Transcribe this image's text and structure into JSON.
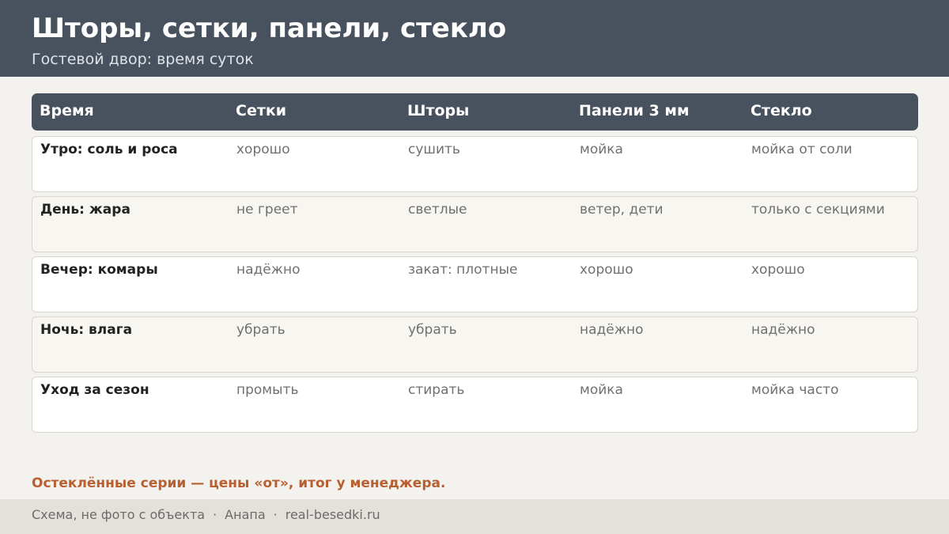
{
  "header": {
    "title": "Шторы, сетки, панели, стекло",
    "subtitle": "Гостевой двор: время суток"
  },
  "table": {
    "columns": [
      "Время",
      "Сетки",
      "Шторы",
      "Панели 3 мм",
      "Стекло"
    ],
    "rows": [
      [
        "Утро: соль и роса",
        "хорошо",
        "сушить",
        "мойка",
        "мойка от соли"
      ],
      [
        "День: жара",
        "не греет",
        "светлые",
        "ветер, дети",
        "только с секциями"
      ],
      [
        "Вечер: комары",
        "надёжно",
        "закат: плотные",
        "хорошо",
        "хорошо"
      ],
      [
        "Ночь: влага",
        "убрать",
        "убрать",
        "надёжно",
        "надёжно"
      ],
      [
        "Уход за сезон",
        "промыть",
        "стирать",
        "мойка",
        "мойка часто"
      ]
    ]
  },
  "note": "Остеклённые серии — цены «от», итог у менеджера.",
  "footer": {
    "items": [
      "Схема, не фото с объекта",
      "Анапа",
      "real-besedki.ru"
    ],
    "separator": "·"
  },
  "colors": {
    "header_bg": "#48515e",
    "page_bg": "#f4f2ee",
    "accent": "#b85f30",
    "footer_bg": "#e4e1da"
  }
}
